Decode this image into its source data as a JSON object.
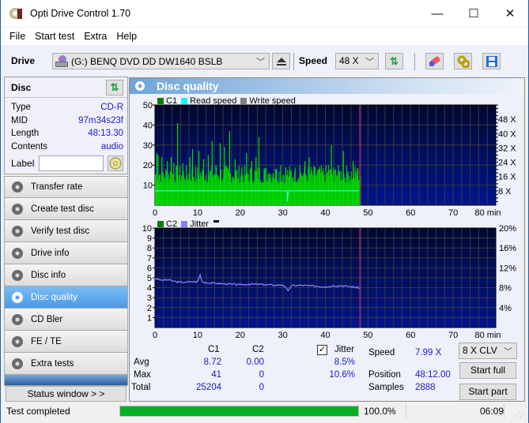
{
  "window": {
    "title": "Opti Drive Control 1.70",
    "minimize": "—",
    "maximize": "☐",
    "close": "✕"
  },
  "menu": [
    "File",
    "Start test",
    "Extra",
    "Help"
  ],
  "toolbar": {
    "drive_label": "Drive",
    "drive_value": "(G:)   BENQ DVD DD DW1640 BSLB",
    "speed_label": "Speed",
    "speed_value": "48 X"
  },
  "disc": {
    "header": "Disc",
    "rows": [
      {
        "k": "Type",
        "v": "CD-R"
      },
      {
        "k": "MID",
        "v": "97m34s23f"
      },
      {
        "k": "Length",
        "v": "48:13.30"
      },
      {
        "k": "Contents",
        "v": "audio"
      }
    ],
    "label_label": "Label",
    "label_value": ""
  },
  "nav": [
    {
      "label": "Transfer rate",
      "active": false
    },
    {
      "label": "Create test disc",
      "active": false
    },
    {
      "label": "Verify test disc",
      "active": false
    },
    {
      "label": "Drive info",
      "active": false
    },
    {
      "label": "Disc info",
      "active": false
    },
    {
      "label": "Disc quality",
      "active": true
    },
    {
      "label": "CD Bler",
      "active": false
    },
    {
      "label": "FE / TE",
      "active": false
    },
    {
      "label": "Extra tests",
      "active": false
    }
  ],
  "status_window_button": "Status window > >",
  "main": {
    "title": "Disc quality"
  },
  "chart_data": [
    {
      "type": "bar",
      "title": "C1",
      "legend": [
        {
          "name": "C1",
          "color": "#008000"
        },
        {
          "name": "Read speed",
          "color": "#00ffff"
        },
        {
          "name": "Write speed",
          "color": "#808080"
        }
      ],
      "x_ticks": [
        "0",
        "10",
        "20",
        "30",
        "40",
        "50",
        "60",
        "70",
        "80 min"
      ],
      "xlim": [
        0,
        80
      ],
      "y_ticks": [
        "10",
        "20",
        "30",
        "40",
        "50"
      ],
      "ylim": [
        0,
        50
      ],
      "y2_ticks": [
        "8 X",
        "16 X",
        "24 X",
        "32 X",
        "40 X",
        "48 X"
      ],
      "y2lim": [
        0,
        56
      ],
      "end_marker_min": 48.2,
      "read_speed_x": 8,
      "c1_series": {
        "fill_level": 11,
        "peaks": [
          [
            0.3,
            26
          ],
          [
            0.6,
            25
          ],
          [
            1.5,
            24
          ],
          [
            2.8,
            22
          ],
          [
            3.7,
            24
          ],
          [
            4.3,
            21
          ],
          [
            5.2,
            41
          ],
          [
            6.4,
            21
          ],
          [
            8.1,
            24
          ],
          [
            8.7,
            28
          ],
          [
            10.2,
            27
          ],
          [
            11.3,
            23
          ],
          [
            12.4,
            25
          ],
          [
            13.3,
            32
          ],
          [
            14.2,
            20
          ],
          [
            15.2,
            31
          ],
          [
            16.2,
            29
          ],
          [
            17.4,
            37
          ],
          [
            18.7,
            23
          ],
          [
            20.3,
            19
          ],
          [
            21.4,
            26
          ],
          [
            22.6,
            22
          ],
          [
            23.6,
            24
          ],
          [
            24.3,
            34
          ],
          [
            25.5,
            18
          ],
          [
            26.7,
            16
          ],
          [
            27.6,
            16
          ],
          [
            28.4,
            18
          ],
          [
            29.4,
            20
          ],
          [
            30.6,
            19
          ],
          [
            31.6,
            16
          ],
          [
            32.7,
            17
          ],
          [
            33.9,
            20
          ],
          [
            35.1,
            22
          ],
          [
            36.1,
            24
          ],
          [
            37.4,
            19
          ],
          [
            38.6,
            18
          ],
          [
            39.4,
            17
          ],
          [
            40.6,
            20
          ],
          [
            41.3,
            30
          ],
          [
            42.3,
            18
          ],
          [
            43.2,
            17
          ],
          [
            44.1,
            27
          ],
          [
            45.2,
            17
          ],
          [
            46.4,
            22
          ],
          [
            47.4,
            18
          ],
          [
            48.0,
            17
          ]
        ]
      }
    },
    {
      "type": "line",
      "title": "C2 / Jitter",
      "legend": [
        {
          "name": "C2",
          "color": "#008000"
        },
        {
          "name": "Jitter",
          "color": "#8080ff"
        }
      ],
      "x_ticks": [
        "0",
        "10",
        "20",
        "30",
        "40",
        "50",
        "60",
        "70",
        "80 min"
      ],
      "xlim": [
        0,
        80
      ],
      "y_ticks": [
        "1",
        "2",
        "3",
        "4",
        "5",
        "6",
        "7",
        "8",
        "9",
        "10"
      ],
      "ylim": [
        0,
        10
      ],
      "y2_ticks": [
        "4%",
        "8%",
        "12%",
        "16%",
        "20%"
      ],
      "y2lim": [
        0,
        20
      ],
      "end_marker_min": 48.2,
      "jitter_pct": [
        [
          0,
          9.9
        ],
        [
          1,
          9.6
        ],
        [
          2,
          9.5
        ],
        [
          3,
          9.6
        ],
        [
          4,
          9.4
        ],
        [
          5,
          9.2
        ],
        [
          6,
          9.1
        ],
        [
          7,
          9.1
        ],
        [
          8,
          9.2
        ],
        [
          9,
          9.2
        ],
        [
          10,
          9.2
        ],
        [
          10.6,
          10.6
        ],
        [
          11,
          9.2
        ],
        [
          12,
          9.0
        ],
        [
          14,
          8.9
        ],
        [
          16,
          8.8
        ],
        [
          18,
          8.7
        ],
        [
          20,
          8.6
        ],
        [
          22,
          8.7
        ],
        [
          24,
          8.7
        ],
        [
          26,
          8.6
        ],
        [
          28,
          8.5
        ],
        [
          30,
          8.6
        ],
        [
          31.2,
          7.4
        ],
        [
          32,
          8.4
        ],
        [
          34,
          8.5
        ],
        [
          36,
          8.4
        ],
        [
          38,
          8.3
        ],
        [
          40,
          8.2
        ],
        [
          42,
          8.4
        ],
        [
          44,
          8.4
        ],
        [
          46,
          8.2
        ],
        [
          48,
          8.0
        ]
      ],
      "c2_values": 0
    }
  ],
  "stats": {
    "col_c1": "C1",
    "col_c2": "C2",
    "jitter_label": "Jitter",
    "jitter_checked": true,
    "rows": [
      {
        "label": "Avg",
        "c1": "8.72",
        "c2": "0.00",
        "jitter": "8.5%"
      },
      {
        "label": "Max",
        "c1": "41",
        "c2": "0",
        "jitter": "10.6%"
      },
      {
        "label": "Total",
        "c1": "25204",
        "c2": "0",
        "jitter": ""
      }
    ],
    "speed_label": "Speed",
    "speed_value": "7.99 X",
    "position_label": "Position",
    "position_value": "48:12.00",
    "samples_label": "Samples",
    "samples_value": "2888",
    "mode_value": "8 X CLV",
    "start_full": "Start full",
    "start_part": "Start part"
  },
  "statusbar": {
    "text": "Test completed",
    "progress": 1.0,
    "progress_text": "100.0%",
    "time": "06:09"
  }
}
